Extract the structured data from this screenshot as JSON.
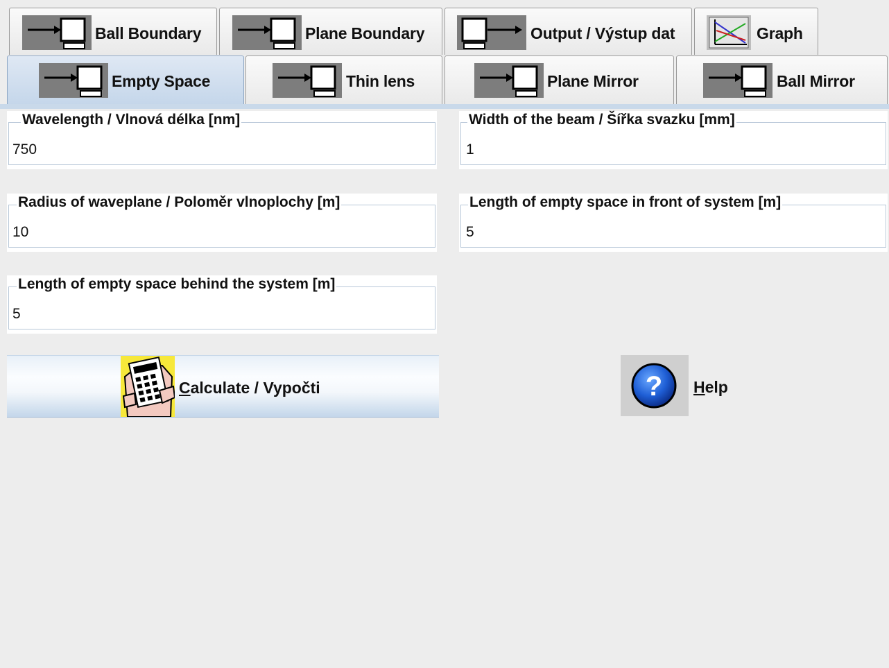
{
  "tabs": {
    "row1": [
      {
        "label": "Ball Boundary",
        "icon": "arrow-into-monitor-icon"
      },
      {
        "label": "Plane Boundary",
        "icon": "arrow-into-monitor-icon"
      },
      {
        "label": "Output / Výstup dat",
        "icon": "monitor-arrow-out-icon"
      },
      {
        "label": "Graph",
        "icon": "graph-icon"
      }
    ],
    "row2": [
      {
        "label": "Empty Space",
        "icon": "arrow-into-monitor-icon",
        "selected": true
      },
      {
        "label": "Thin lens",
        "icon": "arrow-into-monitor-icon"
      },
      {
        "label": "Plane Mirror",
        "icon": "arrow-into-monitor-icon"
      },
      {
        "label": "Ball Mirror",
        "icon": "arrow-into-monitor-icon"
      }
    ]
  },
  "fields": {
    "wavelength": {
      "label": "Wavelength / Vlnová délka [nm]",
      "value": "750"
    },
    "beam_width": {
      "label": "Width of the beam / Šířka svazku [mm]",
      "value": "1"
    },
    "radius": {
      "label": "Radius of waveplane / Poloměr vlnoplochy [m]",
      "value": "10"
    },
    "front_length": {
      "label": "Length of empty space in front of system [m]",
      "value": "5"
    },
    "behind_length": {
      "label": "Length of empty space behind the system [m]",
      "value": "5"
    }
  },
  "buttons": {
    "calculate": {
      "mnemonic": "C",
      "rest": "alculate / Vypočti",
      "icon": "calculator-hand-icon"
    },
    "help": {
      "mnemonic": "H",
      "rest": "elp",
      "icon": "question-icon"
    }
  },
  "colors": {
    "background": "#ededed",
    "selected_tab": "#c4d6ea",
    "accent_line": "#c9d9ea",
    "icon_tile": "#7d7d7d"
  }
}
